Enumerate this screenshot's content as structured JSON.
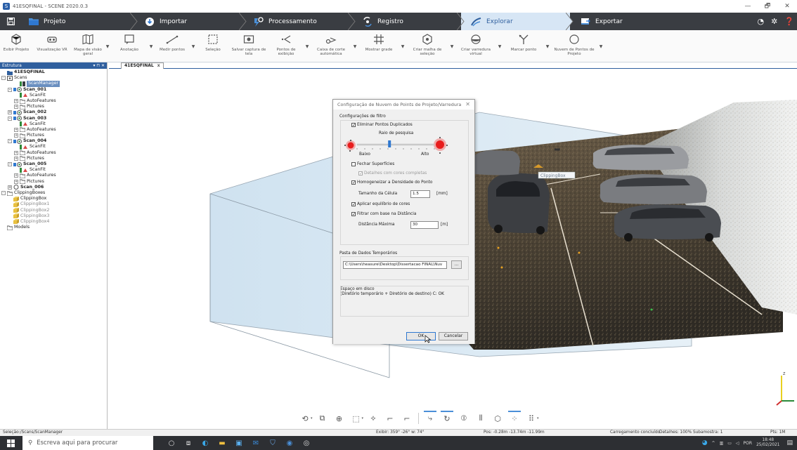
{
  "window": {
    "title": "41ESQFINAL - SCENE 2020.0.3",
    "app_icon": "S",
    "minimize": "—",
    "restore": "🗗",
    "close": "✕"
  },
  "tabs": {
    "projeto": "Projeto",
    "importar": "Importar",
    "processamento": "Processamento",
    "registro": "Registro",
    "explorar": "Explorar",
    "exportar": "Exportar"
  },
  "ribbon": [
    {
      "label": "Exibir Projeto",
      "icon": "project-view-icon"
    },
    {
      "label": "Visualização VR",
      "icon": "vr-headset-icon"
    },
    {
      "label": "Mapa de visão geral",
      "icon": "map-icon",
      "dropdown": true
    },
    {
      "label": "Anotação",
      "icon": "annotation-icon",
      "dropdown": true
    },
    {
      "label": "Medir pontos",
      "icon": "measure-icon",
      "dropdown": true
    },
    {
      "label": "Seleção",
      "icon": "selection-icon"
    },
    {
      "label": "Salvar captura de tela",
      "icon": "screenshot-icon"
    },
    {
      "label": "Pontos de exibição",
      "icon": "display-points-icon",
      "dropdown": true
    },
    {
      "label": "Caixa de corte automática",
      "icon": "clipping-box-icon",
      "dropdown": true
    },
    {
      "label": "Mostrar grade",
      "icon": "grid-icon",
      "dropdown": true
    },
    {
      "label": "Criar malha de seleção",
      "icon": "mesh-icon",
      "dropdown": true
    },
    {
      "label": "Criar varredura virtual",
      "icon": "virtual-scan-icon",
      "dropdown": true
    },
    {
      "label": "Marcar ponto",
      "icon": "mark-point-icon",
      "dropdown": true
    },
    {
      "label": "Nuvem de Pontos de Projeto",
      "icon": "point-cloud-icon",
      "dropdown": true
    }
  ],
  "sidebar": {
    "header": "Estrutura",
    "controls": "▾ ⊓ ✕",
    "tree": [
      {
        "label": "41ESQFINAL",
        "level": 0,
        "bold": true,
        "icon": "project"
      },
      {
        "label": "Scans",
        "level": 0,
        "toggle": "-",
        "icon": "scans"
      },
      {
        "label": "ScanManager",
        "level": 2,
        "icon": "manager",
        "selected": true
      },
      {
        "label": "Scan_001",
        "level": 1,
        "toggle": "-",
        "bold": true,
        "icon": "scan"
      },
      {
        "label": "ScanFit",
        "level": 2,
        "icon": "scanfit"
      },
      {
        "label": "AutoFeatures",
        "level": 2,
        "toggle": "+",
        "icon": "folder"
      },
      {
        "label": "Pictures",
        "level": 2,
        "toggle": "+",
        "icon": "folder"
      },
      {
        "label": "Scan_002",
        "level": 1,
        "toggle": "+",
        "bold": true,
        "icon": "scan"
      },
      {
        "label": "Scan_003",
        "level": 1,
        "toggle": "-",
        "bold": true,
        "icon": "scan"
      },
      {
        "label": "ScanFit",
        "level": 2,
        "icon": "scanfit"
      },
      {
        "label": "AutoFeatures",
        "level": 2,
        "toggle": "+",
        "icon": "folder"
      },
      {
        "label": "Pictures",
        "level": 2,
        "toggle": "+",
        "icon": "folder"
      },
      {
        "label": "Scan_004",
        "level": 1,
        "toggle": "-",
        "bold": true,
        "icon": "scan"
      },
      {
        "label": "ScanFit",
        "level": 2,
        "icon": "scanfit"
      },
      {
        "label": "AutoFeatures",
        "level": 2,
        "toggle": "+",
        "icon": "folder"
      },
      {
        "label": "Pictures",
        "level": 2,
        "toggle": "+",
        "icon": "folder"
      },
      {
        "label": "Scan_005",
        "level": 1,
        "toggle": "-",
        "bold": true,
        "icon": "scan"
      },
      {
        "label": "ScanFit",
        "level": 2,
        "icon": "scanfit"
      },
      {
        "label": "AutoFeatures",
        "level": 2,
        "toggle": "+",
        "icon": "folder"
      },
      {
        "label": "Pictures",
        "level": 2,
        "toggle": "+",
        "icon": "folder"
      },
      {
        "label": "Scan_006",
        "level": 1,
        "toggle": "+",
        "bold": true,
        "icon": "scan-empty"
      },
      {
        "label": "ClippingBoxes",
        "level": 0,
        "toggle": "-",
        "icon": "folder"
      },
      {
        "label": "ClippingBox",
        "level": 1,
        "icon": "box"
      },
      {
        "label": "ClippingBox1",
        "level": 1,
        "icon": "box",
        "dim": true
      },
      {
        "label": "ClippingBox2",
        "level": 1,
        "icon": "box",
        "dim": true
      },
      {
        "label": "ClippingBox3",
        "level": 1,
        "icon": "box",
        "dim": true
      },
      {
        "label": "ClippingBox4",
        "level": 1,
        "icon": "box",
        "dim": true
      },
      {
        "label": "Models",
        "level": 0,
        "icon": "folder"
      }
    ]
  },
  "document_tab": {
    "label": "41ESQFINAL",
    "close": "x"
  },
  "viewport": {
    "clipping_label": "ClippingBox"
  },
  "dialog": {
    "title": "Configuração de Nuvem de Points de Projeto/Varredura",
    "close": "✕",
    "filter_group": "Configurações de filtro",
    "eliminate_duplicates": {
      "label": "Eliminar Pontos Duplicados",
      "checked": true
    },
    "search_radius": {
      "label": "Raio de pesquisa",
      "low": "Baixo",
      "high": "Alto",
      "value": 0.42
    },
    "close_surfaces": {
      "label": "Fechar Superfícies",
      "checked": false
    },
    "full_color_details": {
      "label": "Detalhes com cores completas",
      "checked": true
    },
    "homogenize": {
      "label": "Homogeneizar a Densidade do Ponto",
      "checked": true
    },
    "cell_size": {
      "label": "Tamanho da Célula",
      "value": "1.5",
      "unit": "[mm]"
    },
    "color_balance": {
      "label": "Aplicar equilíbrio de cores",
      "checked": true
    },
    "distance_filter": {
      "label": "Filtrar com base na Distância",
      "checked": true
    },
    "max_distance": {
      "label": "Distância Máxima",
      "value": "30",
      "unit": "[m]"
    },
    "temp_group": "Pasta de Dados Temporários",
    "temp_path": "C:\\Users\\heasure\\Desktop\\Dissertacao FINAL\\Nuv",
    "browse": "...",
    "disk_space_title": "Espaço em disco",
    "disk_space_text": "(Diretório temporário + Diretório de destino) C: OK",
    "ok": "OK",
    "cancel": "Cancelar",
    "check_mark": "✓"
  },
  "navbar": [
    {
      "icon": "rotate-icon",
      "glyph": "⟲",
      "dd": true
    },
    {
      "icon": "pan-icon",
      "glyph": "⧉"
    },
    {
      "icon": "zoom-icon",
      "glyph": "⊕"
    },
    {
      "icon": "view-cube-icon",
      "glyph": "⬚",
      "dd": true
    },
    {
      "icon": "split-icon",
      "glyph": "⟡"
    },
    {
      "icon": "walk-icon",
      "glyph": "⌐"
    },
    {
      "icon": "fly-icon",
      "glyph": "⌐"
    },
    {
      "icon": "clip-active-icon",
      "glyph": "⤷",
      "active": true
    },
    {
      "icon": "orbit-icon",
      "glyph": "↻",
      "active": true
    },
    {
      "icon": "center-icon",
      "glyph": "⦶"
    },
    {
      "icon": "layers-icon",
      "glyph": "⦀"
    },
    {
      "icon": "box-icon",
      "glyph": "⬡"
    },
    {
      "icon": "points-icon",
      "glyph": "⁘",
      "active": true
    },
    {
      "icon": "more-icon",
      "glyph": "⠿",
      "dd": true
    }
  ],
  "status": {
    "path": "Seleção:/Scans/ScanManager",
    "view": "Exibir: 359° -26° w: 74°",
    "pos": "Pos: -0.28m -13.74m -11.99m",
    "loading": "Carregamento concluído",
    "details": "Detalhes: 100%  Subamostra: 1",
    "pts": "Pts: 1M"
  },
  "taskbar": {
    "search_placeholder": "Escreva aqui para procurar",
    "language": "POR",
    "time": "18:48",
    "date": "25/02/2021"
  },
  "colors": {
    "accent": "#2f5f9e",
    "active_tab": "#d7e6f5",
    "dark": "#3a3d42"
  }
}
